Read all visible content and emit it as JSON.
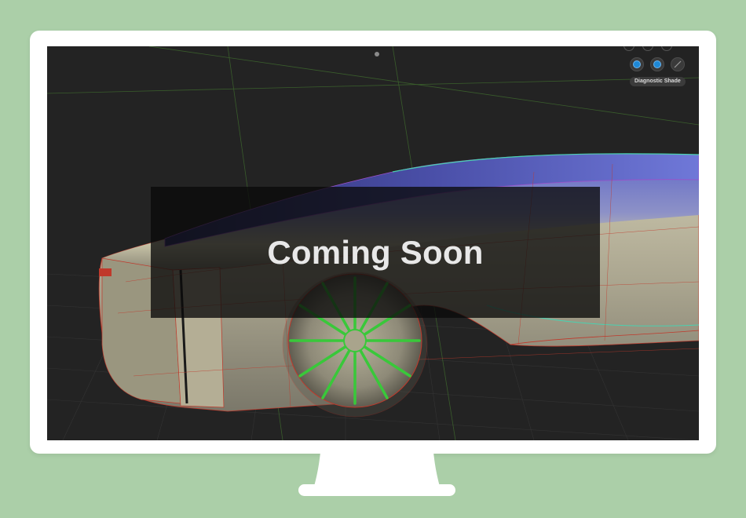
{
  "viewport": {
    "overlay_title": "Coming Soon",
    "diagnostic_label": "Diagnostic Shade"
  },
  "toolbar": {
    "buttons": [
      {
        "icon": "shade-mode-icon",
        "active": true
      },
      {
        "icon": "shade-mode-alt-icon",
        "active": true
      },
      {
        "icon": "wireframe-icon",
        "active": false
      }
    ]
  },
  "colors": {
    "background": "#abcfa8",
    "frame": "#ffffff",
    "screen": "#232323",
    "accent": "#1e88d6",
    "overlay": "#0a0a0a"
  }
}
